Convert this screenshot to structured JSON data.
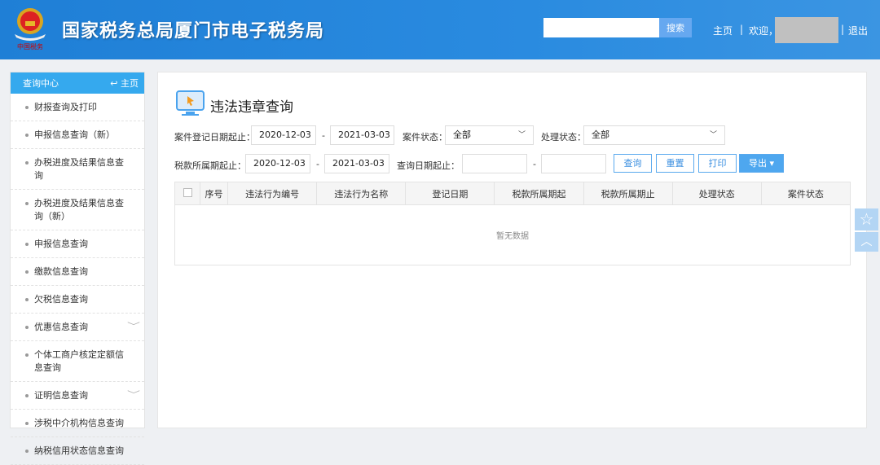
{
  "header": {
    "title": "国家税务总局厦门市电子税务局",
    "emblem_caption": "中国税务",
    "search_placeholder": "",
    "search_button": "搜索",
    "home": "主页",
    "sep": "|",
    "welcome": "欢迎，",
    "logout": "退出"
  },
  "sidebar": {
    "title": "查询中心",
    "home": "主页",
    "items": [
      {
        "label": "财报查询及打印"
      },
      {
        "label": "申报信息查询（新）"
      },
      {
        "label": "办税进度及结果信息查询"
      },
      {
        "label": "办税进度及结果信息查询（新）"
      },
      {
        "label": "申报信息查询"
      },
      {
        "label": "缴款信息查询"
      },
      {
        "label": "欠税信息查询"
      },
      {
        "label": "优惠信息查询",
        "expandable": true
      },
      {
        "label": "个体工商户核定定额信息查询"
      },
      {
        "label": "证明信息查询",
        "expandable": true
      },
      {
        "label": "涉税中介机构信息查询"
      },
      {
        "label": "纳税信用状态信息查询"
      }
    ]
  },
  "main": {
    "title": "违法违章查询",
    "filters": {
      "reg_date_label": "案件登记日期起止：",
      "reg_from": "2020-12-03",
      "reg_to": "2021-03-03",
      "dash": "-",
      "case_status_label": "案件状态：",
      "case_status": "全部",
      "proc_status_label": "处理状态：",
      "proc_status": "全部",
      "tax_period_label": "税款所属期起止：",
      "tax_from": "2020-12-03",
      "tax_to": "2021-03-03",
      "query_date_label": "查询日期起止：",
      "query_from": "",
      "query_to": ""
    },
    "buttons": {
      "query": "查询",
      "reset": "重置",
      "print": "打印",
      "export": "导出"
    },
    "table": {
      "columns": [
        "序号",
        "违法行为编号",
        "违法行为名称",
        "登记日期",
        "税款所属期起",
        "税款所属期止",
        "处理状态",
        "案件状态"
      ],
      "empty": "暂无数据"
    }
  }
}
